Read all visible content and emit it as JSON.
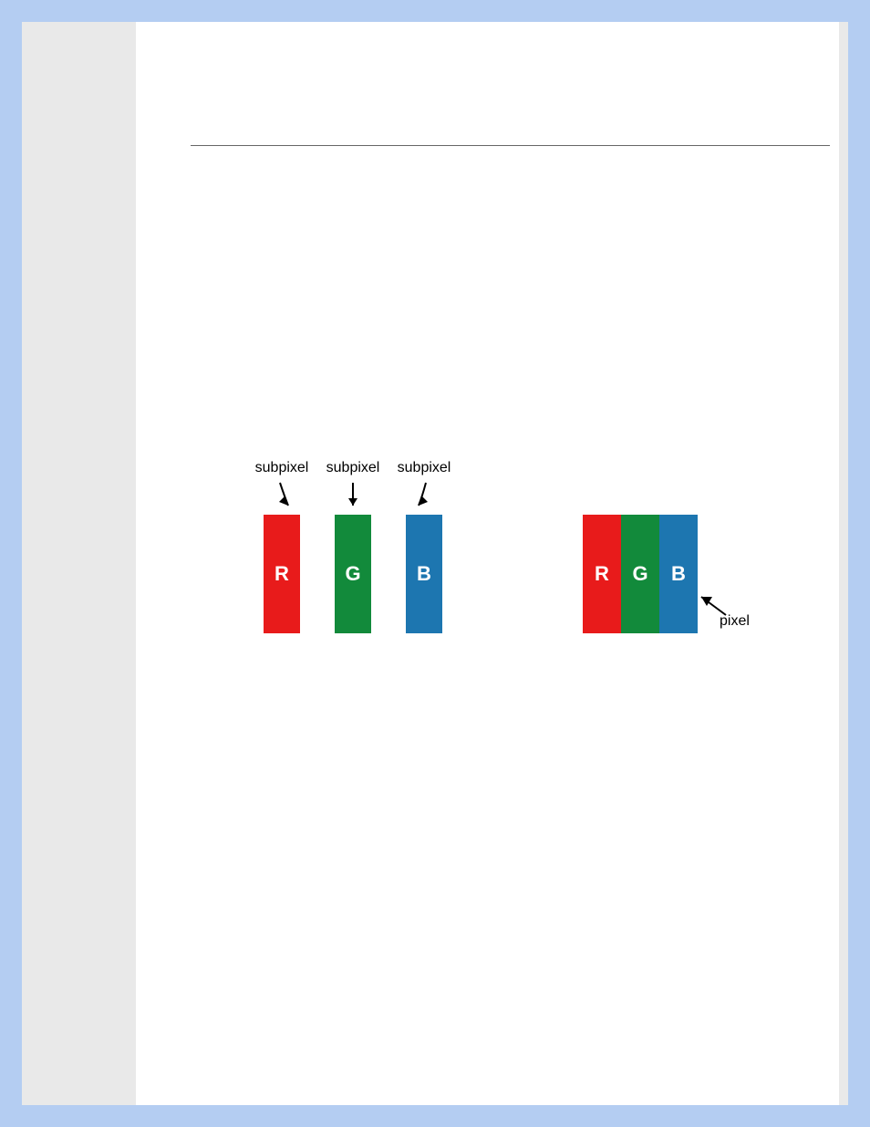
{
  "diagram": {
    "subpixel_labels": {
      "l1": "subpixel",
      "l2": "subpixel",
      "l3": "subpixel"
    },
    "letters": {
      "r": "R",
      "g": "G",
      "b": "B"
    },
    "combo_letters": {
      "r": "R",
      "g": "G",
      "b": "B"
    },
    "pixel_label": "pixel"
  },
  "colors": {
    "red": "#e81b1b",
    "green": "#128a3b",
    "blue": "#1d76b0"
  }
}
